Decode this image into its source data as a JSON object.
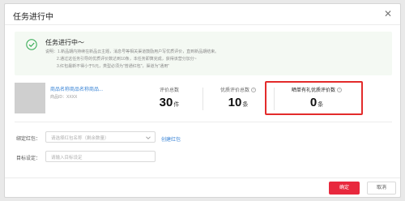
{
  "dialog": {
    "title": "任务进行中",
    "close_glyph": "✕"
  },
  "status": {
    "icon": "check-circle-icon",
    "title": "任务进行中～",
    "desc_lines": [
      "说明：1.新品期内持续在新品云主题，消息号等相关渠道鼓励用户写优质评价，直到新品期结束。",
      "2.通过这任务引导的优质评价数达到10条，本任务即算完成，获得该营分加分~",
      "3.红包最新不得小于5元，类型必须为\"普通红包\"，渠道为\"通用\""
    ],
    "accent_color": "#2fa84f"
  },
  "goods": {
    "name": "商品名称商品名称商品...",
    "id_text": "商品ID：XXXX"
  },
  "stats": [
    {
      "label": "评价总数",
      "value": "30",
      "unit": "件",
      "help": false
    },
    {
      "label": "优质评价总数",
      "value": "10",
      "unit": "条",
      "help": true
    },
    {
      "label": "晒单有礼优质评价数",
      "value": "0",
      "unit": "条",
      "help": true
    }
  ],
  "help_glyph": "?",
  "form": {
    "redpacket_label": "绑定红包：",
    "redpacket_placeholder": "请选择红包名称（剩余数量）",
    "create_link": "创建红包",
    "target_label": "目标设定：",
    "target_placeholder": "请输入目标设定"
  },
  "footer": {
    "ok_label": "确定",
    "cancel_label": "取消"
  },
  "colors": {
    "primary": "#e8283d",
    "link": "#3b85d6",
    "highlight_border": "#e32b2b"
  }
}
